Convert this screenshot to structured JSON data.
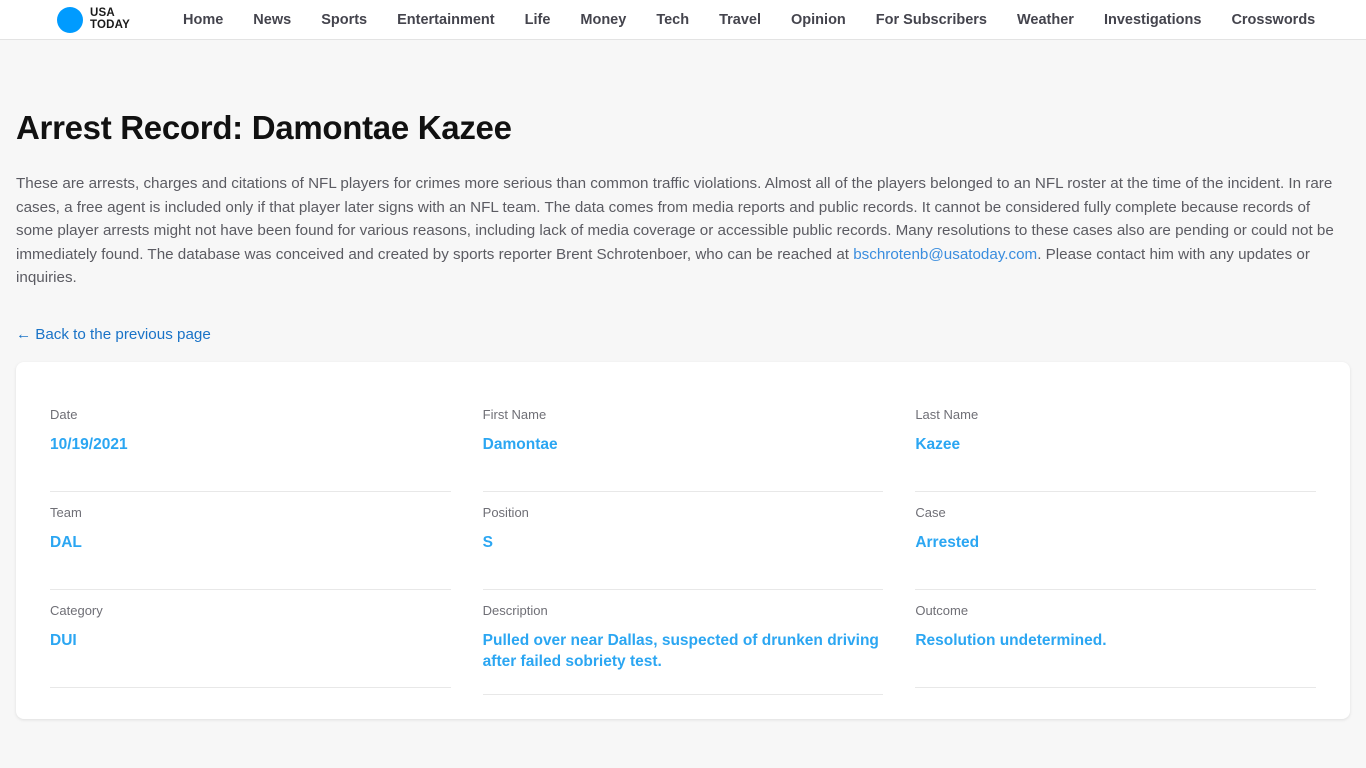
{
  "header": {
    "logo": {
      "icon": "usa-today-circle-logo",
      "line1": "USA",
      "line2": "TODAY"
    },
    "nav_items": [
      {
        "label": "Home"
      },
      {
        "label": "News"
      },
      {
        "label": "Sports"
      },
      {
        "label": "Entertainment"
      },
      {
        "label": "Life"
      },
      {
        "label": "Money"
      },
      {
        "label": "Tech"
      },
      {
        "label": "Travel"
      },
      {
        "label": "Opinion"
      },
      {
        "label": "For Subscribers"
      },
      {
        "label": "Weather"
      },
      {
        "label": "Investigations"
      },
      {
        "label": "Crosswords"
      }
    ]
  },
  "main": {
    "title": "Arrest Record: Damontae Kazee",
    "intro_part1": "These are arrests, charges and citations of NFL players for crimes more serious than common traffic violations. Almost all of the players belonged to an NFL roster at the time of the incident. In rare cases, a free agent is included only if that player later signs with an NFL team. The data comes from media reports and public records. It cannot be considered fully complete because records of some player arrests might not have been found for various reasons, including lack of media coverage or accessible public records. Many resolutions to these cases also are pending or could not be immediately found. The database was conceived and created by sports reporter Brent Schrotenboer, who can be reached at ",
    "intro_email": "bschrotenb@usatoday.com",
    "intro_part2": ". Please contact him with any updates or inquiries.",
    "back_link": {
      "arrow": "←",
      "label": "Back to the previous page"
    }
  },
  "record": {
    "fields": [
      {
        "label": "Date",
        "value": "10/19/2021"
      },
      {
        "label": "First Name",
        "value": "Damontae"
      },
      {
        "label": "Last Name",
        "value": "Kazee"
      },
      {
        "label": "Team",
        "value": "DAL"
      },
      {
        "label": "Position",
        "value": "S"
      },
      {
        "label": "Case",
        "value": "Arrested"
      },
      {
        "label": "Category",
        "value": "DUI"
      },
      {
        "label": "Description",
        "value": "Pulled over near Dallas, suspected of drunken driving after failed sobriety test."
      },
      {
        "label": "Outcome",
        "value": "Resolution undetermined."
      }
    ]
  },
  "colors": {
    "brand_blue": "#009bff",
    "value_blue": "#2ba6f2",
    "link_blue": "#1a73c7",
    "page_background": "#f7f7f7",
    "card_background": "#ffffff"
  }
}
